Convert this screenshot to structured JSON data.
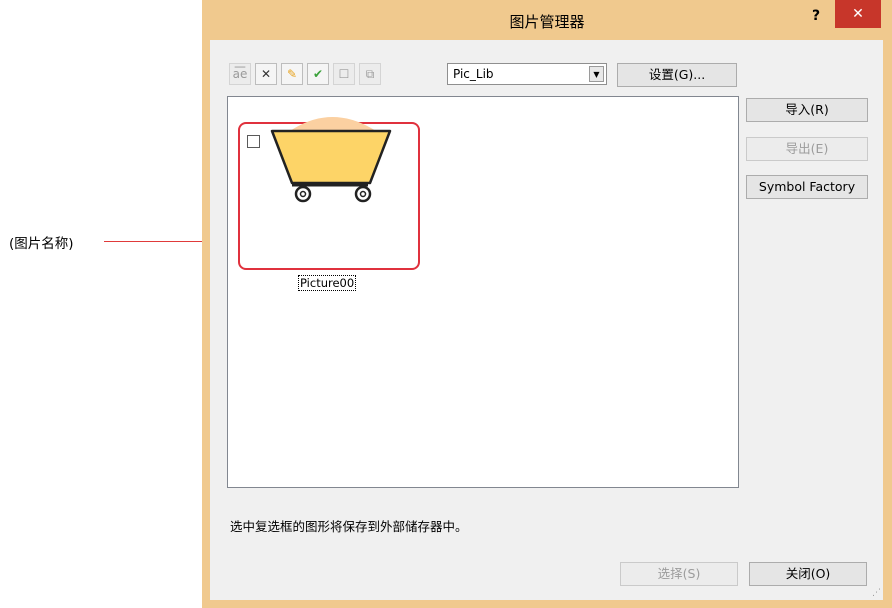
{
  "callout": {
    "label": "(图片名称)"
  },
  "dialog": {
    "title": "图片管理器",
    "help_label": "?",
    "close_label": "✕"
  },
  "toolbar": {
    "tools": [
      {
        "name": "rename-tool",
        "glyph": "a͞e",
        "enabled": false
      },
      {
        "name": "delete-tool",
        "glyph": "✕",
        "enabled": true
      },
      {
        "name": "edit-tool",
        "glyph": "✎",
        "enabled": true
      },
      {
        "name": "check-tool",
        "glyph": "✔",
        "enabled": true
      },
      {
        "name": "uncheck-tool",
        "glyph": "☐",
        "enabled": false
      },
      {
        "name": "copy-tool",
        "glyph": "⧉",
        "enabled": false
      }
    ],
    "library_select": "Pic_Lib",
    "settings_label": "设置(G)..."
  },
  "side_buttons": {
    "import_label": "导入(R)",
    "export_label": "导出(E)",
    "symbol_factory_label": "Symbol Factory"
  },
  "gallery": {
    "items": [
      {
        "name": "Picture00",
        "checked": false
      }
    ]
  },
  "status_text": "选中复选框的图形将保存到外部储存器中。",
  "footer": {
    "select_label": "选择(S)",
    "close_label": "关闭(O)"
  },
  "colors": {
    "window_frame": "#f0c98e",
    "close_button": "#c7362a",
    "highlight": "#e0313d",
    "cart_fill": "#fdd467",
    "cart_load": "#fbd0a1"
  }
}
